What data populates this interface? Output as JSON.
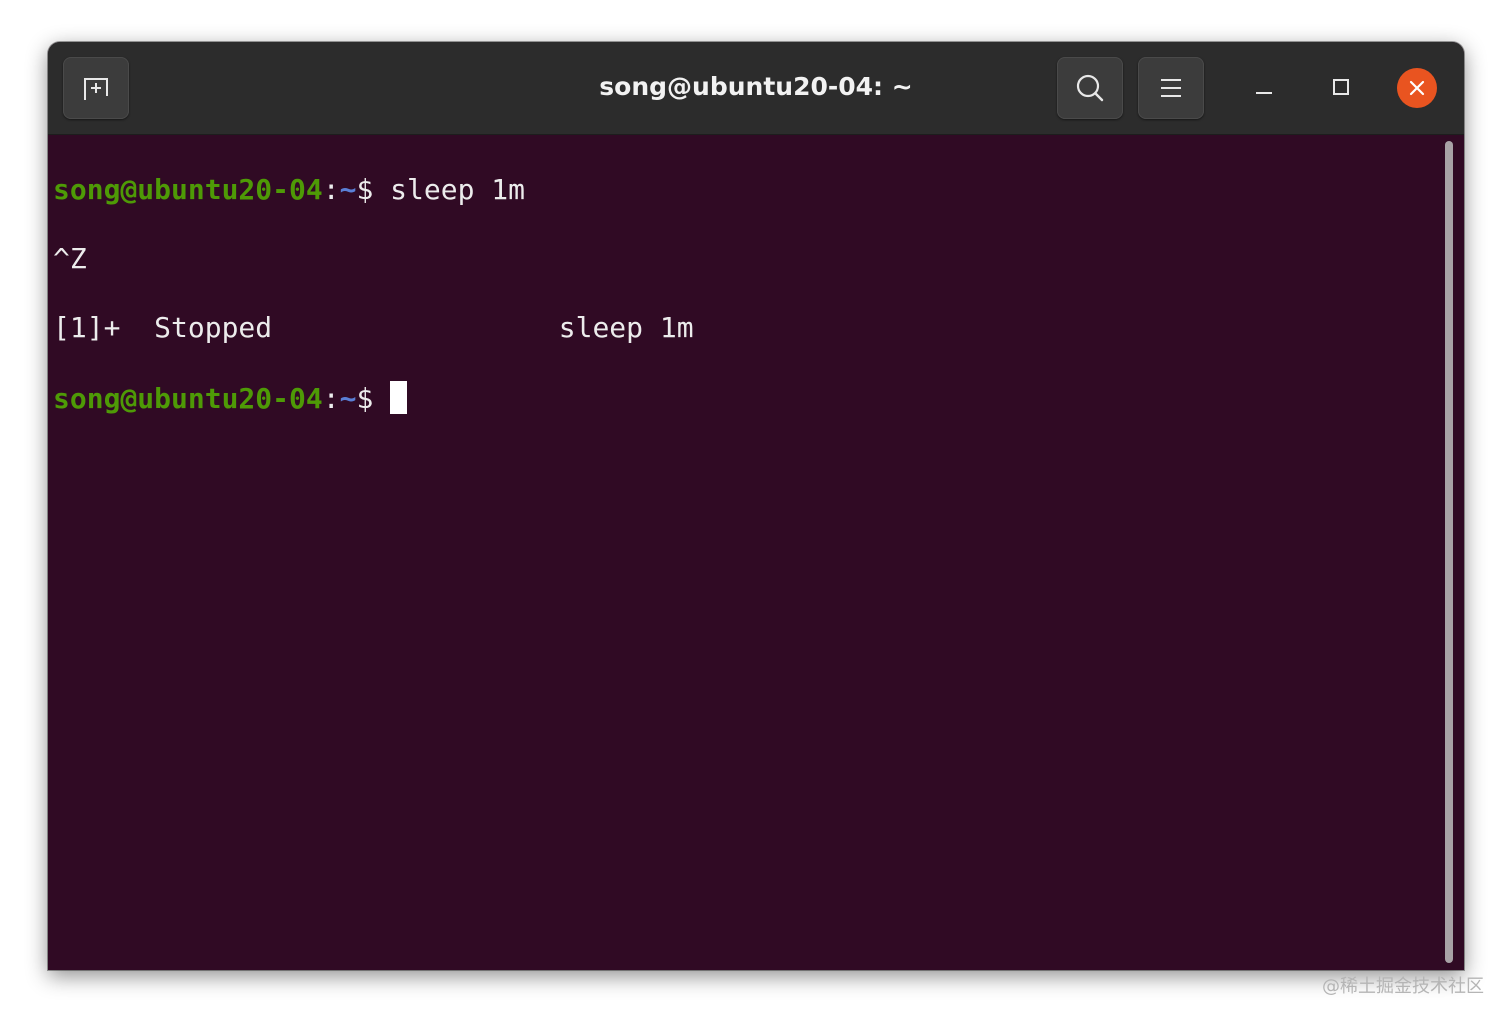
{
  "window": {
    "title": "song@ubuntu20-04: ~"
  },
  "toolbar": {
    "new_tab_icon": "new-tab-icon",
    "search_icon": "search-icon",
    "menu_icon": "hamburger-menu-icon",
    "minimize_icon": "minimize-icon",
    "maximize_icon": "maximize-icon",
    "close_icon": "close-icon"
  },
  "colors": {
    "terminal_bg": "#300a24",
    "prompt_user": "#4e9a06",
    "prompt_path": "#5a7fd6",
    "close_button": "#e95420",
    "titlebar": "#2c2c2c"
  },
  "terminal": {
    "prompt_user_host": "song@ubuntu20-04",
    "prompt_sep": ":",
    "prompt_path": "~",
    "prompt_symbol": "$",
    "lines": [
      {
        "type": "prompt",
        "command": "sleep 1m"
      },
      {
        "type": "output",
        "text": "^Z"
      },
      {
        "type": "output",
        "text": "[1]+  Stopped                 sleep 1m"
      },
      {
        "type": "prompt",
        "command": ""
      }
    ]
  },
  "watermark": "@稀土掘金技术社区"
}
